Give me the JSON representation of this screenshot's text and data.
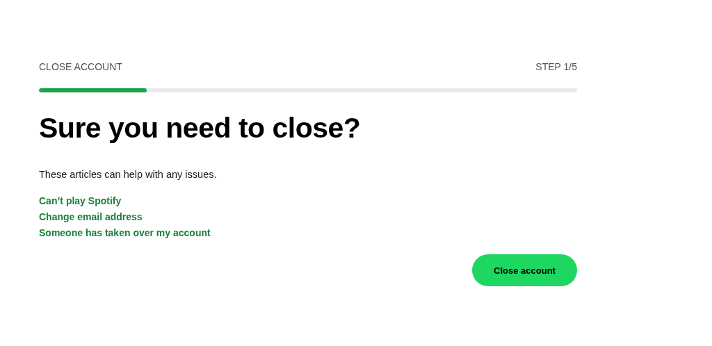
{
  "header": {
    "title": "CLOSE ACCOUNT",
    "step": "STEP 1/5"
  },
  "progress": {
    "level": 0.2
  },
  "heading": "Sure you need to close?",
  "intro": "These articles can help with any issues.",
  "links": [
    "Can’t play Spotify",
    "Change email address",
    "Someone has taken over my account"
  ],
  "buttons": [
    "Close account"
  ]
}
